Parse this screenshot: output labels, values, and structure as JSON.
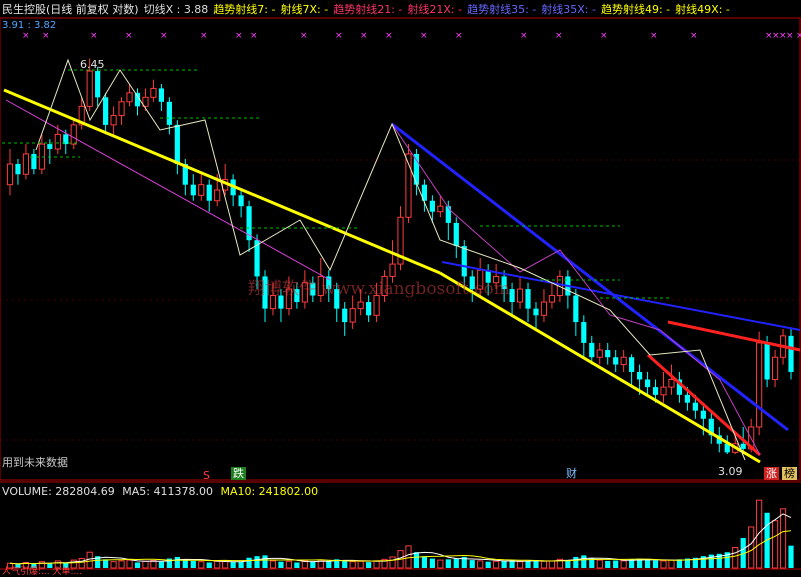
{
  "header": {
    "stock_title": "民生控股(日线 前复权 对数)",
    "items": [
      {
        "label": "切线X : 3.88",
        "color": "#dcdcdc"
      },
      {
        "label": "趋势射线7: -",
        "color": "#ffff00"
      },
      {
        "label": "射线7X: -",
        "color": "#ffff00"
      },
      {
        "label": "趋势射线21: -",
        "color": "#ff3366"
      },
      {
        "label": "射线21X: -",
        "color": "#ff3366"
      },
      {
        "label": "趋势射线35: -",
        "color": "#6666ff"
      },
      {
        "label": "射线35X: -",
        "color": "#6666ff"
      },
      {
        "label": "趋势射线49: -",
        "color": "#ffff00"
      },
      {
        "label": "射线49X: -",
        "color": "#ffff00"
      }
    ],
    "subline": "3.91 : 3.82"
  },
  "labels": {
    "high_price": "6.45",
    "low_price": "3.09",
    "watermark": "翔博软件 www.xiangbosoft.com",
    "future_data": "用到未来数据",
    "sig_s": "S",
    "sig_die": "跌",
    "sig_cai": "财",
    "sig_zhang": "涨",
    "sig_bang": "榜"
  },
  "volume_panel": {
    "label": "VOLUME: 282804.69",
    "ma5": "MA5: 411378.00",
    "ma10": "MA10: 241802.00"
  },
  "bottom_bar": "人气引爆:... 大单:...",
  "colors": {
    "up": "#ff3c3c",
    "down": "#00ffff",
    "ma_yellow": "#ffff00",
    "line_blue": "#3333ff",
    "line_red": "#ff2020",
    "line_magenta": "#ff40ff"
  },
  "chart_data": {
    "type": "candlestick",
    "price_scale": "log",
    "ylim": [
      3.0,
      6.8
    ],
    "candles": [
      [
        5.1,
        5.3,
        5.45,
        5.0
      ],
      [
        5.3,
        5.2,
        5.35,
        5.1
      ],
      [
        5.2,
        5.4,
        5.5,
        5.15
      ],
      [
        5.4,
        5.25,
        5.45,
        5.2
      ],
      [
        5.25,
        5.5,
        5.6,
        5.2
      ],
      [
        5.5,
        5.45,
        5.55,
        5.3
      ],
      [
        5.45,
        5.6,
        5.7,
        5.4
      ],
      [
        5.6,
        5.5,
        5.65,
        5.4
      ],
      [
        5.5,
        5.7,
        5.75,
        5.45
      ],
      [
        5.7,
        5.9,
        6.0,
        5.65
      ],
      [
        5.9,
        6.3,
        6.45,
        5.85
      ],
      [
        6.3,
        6.0,
        6.35,
        5.9
      ],
      [
        6.0,
        5.7,
        6.05,
        5.6
      ],
      [
        5.7,
        5.8,
        5.9,
        5.6
      ],
      [
        5.8,
        5.95,
        6.0,
        5.7
      ],
      [
        5.95,
        6.05,
        6.15,
        5.9
      ],
      [
        6.05,
        5.9,
        6.1,
        5.8
      ],
      [
        5.9,
        6.0,
        6.1,
        5.85
      ],
      [
        6.0,
        6.1,
        6.2,
        5.95
      ],
      [
        6.1,
        5.95,
        6.15,
        5.85
      ],
      [
        5.95,
        5.7,
        6.0,
        5.6
      ],
      [
        5.7,
        5.3,
        5.75,
        5.2
      ],
      [
        5.3,
        5.1,
        5.35,
        5.0
      ],
      [
        5.1,
        5.0,
        5.2,
        4.95
      ],
      [
        5.0,
        5.1,
        5.2,
        4.95
      ],
      [
        5.1,
        4.95,
        5.15,
        4.85
      ],
      [
        4.95,
        5.05,
        5.2,
        4.9
      ],
      [
        5.05,
        5.15,
        5.3,
        5.0
      ],
      [
        5.15,
        5.0,
        5.2,
        4.9
      ],
      [
        5.0,
        4.9,
        5.05,
        4.8
      ],
      [
        4.9,
        4.6,
        4.95,
        4.5
      ],
      [
        4.6,
        4.3,
        4.65,
        4.2
      ],
      [
        4.3,
        4.05,
        4.35,
        3.95
      ],
      [
        4.05,
        4.15,
        4.25,
        4.0
      ],
      [
        4.15,
        4.05,
        4.2,
        3.95
      ],
      [
        4.05,
        4.2,
        4.3,
        4.0
      ],
      [
        4.2,
        4.1,
        4.25,
        4.05
      ],
      [
        4.1,
        4.25,
        4.35,
        4.05
      ],
      [
        4.25,
        4.15,
        4.3,
        4.1
      ],
      [
        4.15,
        4.3,
        4.45,
        4.1
      ],
      [
        4.3,
        4.2,
        4.35,
        4.1
      ],
      [
        4.2,
        4.05,
        4.25,
        3.95
      ],
      [
        4.05,
        3.95,
        4.1,
        3.85
      ],
      [
        3.95,
        4.05,
        4.15,
        3.9
      ],
      [
        4.05,
        4.1,
        4.2,
        4.0
      ],
      [
        4.1,
        4.0,
        4.15,
        3.95
      ],
      [
        4.0,
        4.15,
        4.25,
        3.95
      ],
      [
        4.15,
        4.3,
        4.35,
        4.1
      ],
      [
        4.3,
        4.4,
        4.6,
        4.25
      ],
      [
        4.4,
        4.8,
        4.9,
        4.35
      ],
      [
        4.8,
        5.4,
        5.5,
        4.75
      ],
      [
        5.4,
        5.1,
        5.45,
        5.0
      ],
      [
        5.1,
        4.95,
        5.15,
        4.85
      ],
      [
        4.95,
        4.85,
        5.0,
        4.75
      ],
      [
        4.85,
        4.9,
        5.0,
        4.8
      ],
      [
        4.9,
        4.75,
        4.95,
        4.6
      ],
      [
        4.75,
        4.55,
        4.8,
        4.45
      ],
      [
        4.55,
        4.3,
        4.6,
        4.2
      ],
      [
        4.3,
        4.2,
        4.35,
        4.1
      ],
      [
        4.2,
        4.35,
        4.45,
        4.15
      ],
      [
        4.35,
        4.25,
        4.4,
        4.15
      ],
      [
        4.25,
        4.3,
        4.4,
        4.2
      ],
      [
        4.3,
        4.2,
        4.35,
        4.1
      ],
      [
        4.2,
        4.1,
        4.25,
        4.0
      ],
      [
        4.1,
        4.2,
        4.3,
        4.05
      ],
      [
        4.2,
        4.05,
        4.25,
        3.95
      ],
      [
        4.05,
        4.0,
        4.1,
        3.9
      ],
      [
        4.0,
        4.1,
        4.2,
        3.95
      ],
      [
        4.1,
        4.15,
        4.25,
        4.05
      ],
      [
        4.15,
        4.3,
        4.35,
        4.1
      ],
      [
        4.3,
        4.15,
        4.35,
        4.05
      ],
      [
        4.15,
        3.95,
        4.2,
        3.85
      ],
      [
        3.95,
        3.8,
        4.0,
        3.7
      ],
      [
        3.8,
        3.7,
        3.85,
        3.65
      ],
      [
        3.7,
        3.75,
        3.8,
        3.65
      ],
      [
        3.75,
        3.7,
        3.8,
        3.65
      ],
      [
        3.7,
        3.65,
        3.75,
        3.6
      ],
      [
        3.65,
        3.7,
        3.75,
        3.6
      ],
      [
        3.7,
        3.6,
        3.72,
        3.5
      ],
      [
        3.6,
        3.55,
        3.65,
        3.45
      ],
      [
        3.55,
        3.5,
        3.6,
        3.45
      ],
      [
        3.5,
        3.45,
        3.55,
        3.4
      ],
      [
        3.45,
        3.5,
        3.6,
        3.4
      ],
      [
        3.5,
        3.55,
        3.65,
        3.45
      ],
      [
        3.55,
        3.45,
        3.6,
        3.4
      ],
      [
        3.45,
        3.4,
        3.5,
        3.35
      ],
      [
        3.4,
        3.35,
        3.45,
        3.3
      ],
      [
        3.35,
        3.3,
        3.4,
        3.2
      ],
      [
        3.3,
        3.2,
        3.35,
        3.15
      ],
      [
        3.2,
        3.15,
        3.25,
        3.1
      ],
      [
        3.15,
        3.1,
        3.2,
        3.09
      ],
      [
        3.1,
        3.15,
        3.2,
        3.09
      ],
      [
        3.15,
        3.12,
        3.25,
        3.09
      ],
      [
        3.12,
        3.25,
        3.3,
        3.1
      ],
      [
        3.25,
        3.8,
        3.88,
        3.2
      ],
      [
        3.8,
        3.55,
        3.85,
        3.5
      ],
      [
        3.55,
        3.7,
        3.75,
        3.5
      ],
      [
        3.7,
        3.85,
        3.9,
        3.65
      ],
      [
        3.85,
        3.6,
        3.9,
        3.55
      ]
    ],
    "volume_max": 900000,
    "volumes": [
      60000,
      45000,
      70000,
      50000,
      80000,
      55000,
      90000,
      60000,
      100000,
      120000,
      200000,
      150000,
      110000,
      80000,
      90000,
      100000,
      70000,
      85000,
      95000,
      80000,
      120000,
      140000,
      110000,
      90000,
      80000,
      70000,
      85000,
      90000,
      75000,
      80000,
      130000,
      150000,
      160000,
      90000,
      80000,
      85000,
      70000,
      90000,
      80000,
      100000,
      90000,
      110000,
      100000,
      80000,
      85000,
      75000,
      90000,
      110000,
      140000,
      220000,
      280000,
      200000,
      150000,
      120000,
      100000,
      110000,
      120000,
      140000,
      100000,
      90000,
      80000,
      85000,
      90000,
      95000,
      80000,
      90000,
      100000,
      85000,
      90000,
      110000,
      100000,
      140000,
      160000,
      120000,
      100000,
      90000,
      95000,
      90000,
      110000,
      120000,
      100000,
      95000,
      90000,
      100000,
      110000,
      120000,
      130000,
      150000,
      170000,
      180000,
      200000,
      260000,
      380000,
      520000,
      860000,
      700000,
      600000,
      750000,
      282805
    ]
  }
}
